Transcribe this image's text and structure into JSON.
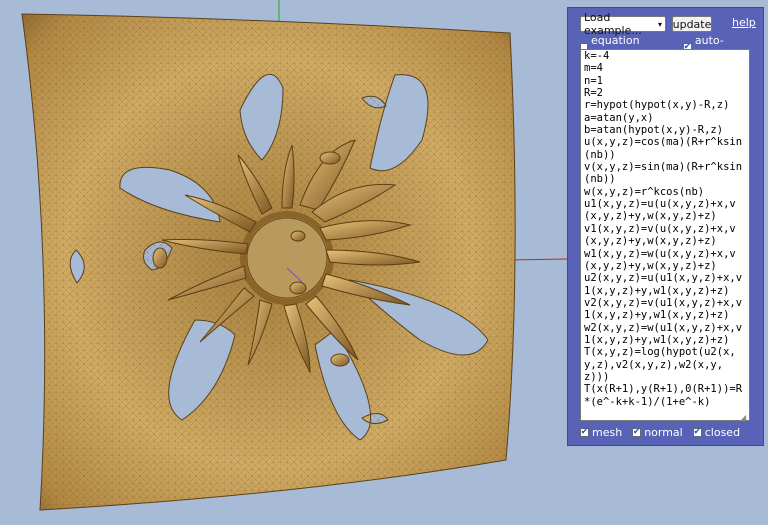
{
  "controls": {
    "example_select": "Load example...",
    "update_label": "update",
    "help_label": "help"
  },
  "options": {
    "equation_preview": {
      "label": "equation preview",
      "checked": false
    },
    "auto_update": {
      "label": "auto-update",
      "checked": true
    }
  },
  "equations": "k=-4\nm=4\nn=1\nR=2\nr=hypot(hypot(x,y)-R,z)\na=atan(y,x)\nb=atan(hypot(x,y)-R,z)\nu(x,y,z)=cos(ma)(R+r^ksin(nb))\nv(x,y,z)=sin(ma)(R+r^ksin(nb))\nw(x,y,z)=r^kcos(nb)\nu1(x,y,z)=u(u(x,y,z)+x,v(x,y,z)+y,w(x,y,z)+z)\nv1(x,y,z)=v(u(x,y,z)+x,v(x,y,z)+y,w(x,y,z)+z)\nw1(x,y,z)=w(u(x,y,z)+x,v(x,y,z)+y,w(x,y,z)+z)\nu2(x,y,z)=u(u1(x,y,z)+x,v1(x,y,z)+y,w1(x,y,z)+z)\nv2(x,y,z)=v(u1(x,y,z)+x,v1(x,y,z)+y,w1(x,y,z)+z)\nw2(x,y,z)=w(u1(x,y,z)+x,v1(x,y,z)+y,w1(x,y,z)+z)\nT(x,y,z)=log(hypot(u2(x,y,z),v2(x,y,z),w2(x,y,z)))\nT(x(R+1),y(R+1),0(R+1))=R*(e^-k+k-1)/(1+e^-k)",
  "display": {
    "mesh": {
      "label": "mesh",
      "checked": true
    },
    "normal": {
      "label": "normal",
      "checked": true
    },
    "closed": {
      "label": "closed",
      "checked": true
    }
  },
  "colors": {
    "background": "#a7bad6",
    "surface": "#c79e55",
    "panel": "#5863b8",
    "axis_y": "#22aa22",
    "axis_x": "#cc2222"
  }
}
